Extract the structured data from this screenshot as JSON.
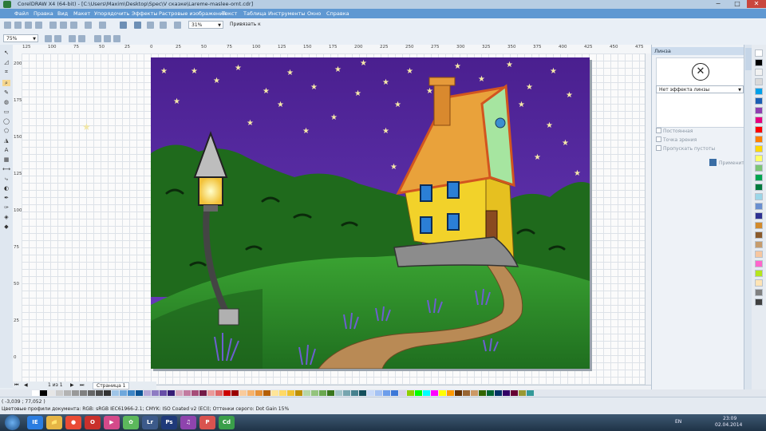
{
  "titlebar": {
    "title": "CorelDRAW X4 (64-bit) - [C:\\Users\\Maxim\\Desktop\\Spec\\V сказке\\Lareme-maslee-ornt.cdr]",
    "minimize_icon": "−",
    "maximize_icon": "□",
    "close_icon": "✕"
  },
  "menu": [
    "Файл",
    "Правка",
    "Вид",
    "Макет",
    "Упорядочить",
    "Эффекты",
    "Растровые изображения",
    "Текст",
    "Таблица",
    "Инструменты",
    "Окно",
    "Справка"
  ],
  "toolbar": {
    "zoom_value": "31%",
    "snap_label": "Привязать к",
    "zoom_level": "75%"
  },
  "ruler_h": [
    "125",
    "100",
    "75",
    "50",
    "25",
    "0",
    "25",
    "50",
    "75",
    "100",
    "125",
    "150",
    "175",
    "200",
    "225",
    "250",
    "275",
    "300",
    "325",
    "350",
    "375",
    "400",
    "425",
    "450",
    "475"
  ],
  "ruler_v": [
    "200",
    "175",
    "150",
    "125",
    "100",
    "75",
    "50",
    "25",
    "0"
  ],
  "docker": {
    "title": "Линза",
    "preview_symbol": "✕",
    "effect_select": "Нет эффекта линзы",
    "options": [
      "Постоянная",
      "Точка зрения",
      "Пропускать пустоты"
    ],
    "apply_label": "Применить"
  },
  "pages": {
    "page_counter": "1 из 1",
    "page_tab": "Страница 1"
  },
  "status": {
    "line1": "( -3,039 ; 77,052 )",
    "line2": "Цветовые профили документа: RGB: sRGB IEC61966-2.1; CMYK: ISO Coated v2 (ECI); Оттенки серого: Dot Gain 15%"
  },
  "colors": {
    "menubar": "#5f98d2",
    "sky_top": "#4a1f8f",
    "sky_bottom": "#6b3fc0",
    "hill": "#2f8a2a",
    "house_wall": "#f2d22a",
    "roof": "#e9a23b",
    "path": "#b98a55"
  },
  "palette": [
    "#ffffff",
    "#000000",
    "#f2f2f2",
    "#d9d9d9",
    "#00a0e9",
    "#1a5fb4",
    "#8f3fb0",
    "#e6007e",
    "#ff0000",
    "#ff7f00",
    "#ffd800",
    "#ffff66",
    "#7cc576",
    "#00a651",
    "#007a3d",
    "#9bd6e8",
    "#6a8fd0",
    "#2e3192",
    "#d28a2c",
    "#8b5a2b",
    "#c69c6d",
    "#f7c7a0",
    "#ff66cc",
    "#b5e61d",
    "#ffe4b5",
    "#808080",
    "#404040"
  ],
  "bottom_palette": [
    "#ffffff",
    "#000000",
    "#e6e6e6",
    "#cccccc",
    "#b3b3b3",
    "#999999",
    "#808080",
    "#666666",
    "#4d4d4d",
    "#333333",
    "#9fc5e8",
    "#6fa8dc",
    "#3d85c6",
    "#0b5394",
    "#b4a7d6",
    "#8e7cc3",
    "#674ea7",
    "#351c75",
    "#d5a6bd",
    "#c27ba0",
    "#a64d79",
    "#741b47",
    "#ea9999",
    "#e06666",
    "#cc0000",
    "#990000",
    "#f9cb9c",
    "#f6b26b",
    "#e69138",
    "#b45f06",
    "#ffe599",
    "#ffd966",
    "#f1c232",
    "#bf9000",
    "#b6d7a8",
    "#93c47d",
    "#6aa84f",
    "#38761d",
    "#a2c4c9",
    "#76a5af",
    "#45818e",
    "#134f5c",
    "#c9daf8",
    "#a4c2f4",
    "#6d9eeb",
    "#3c78d8",
    "#d9d2e9",
    "#8fce00",
    "#00ff00",
    "#00ffff",
    "#ff00ff",
    "#ffff00",
    "#ff9900",
    "#663300",
    "#996633",
    "#cc9966",
    "#336600",
    "#006633",
    "#003366",
    "#330066",
    "#660033",
    "#999933",
    "#339999"
  ],
  "taskbar": {
    "apps": [
      "IE",
      "📁",
      "●",
      "O",
      "▶",
      "✿",
      "Lr",
      "Ps",
      "♫",
      "P",
      "Cd"
    ],
    "lang": "EN",
    "time": "23:09",
    "date": "02.04.2014"
  }
}
